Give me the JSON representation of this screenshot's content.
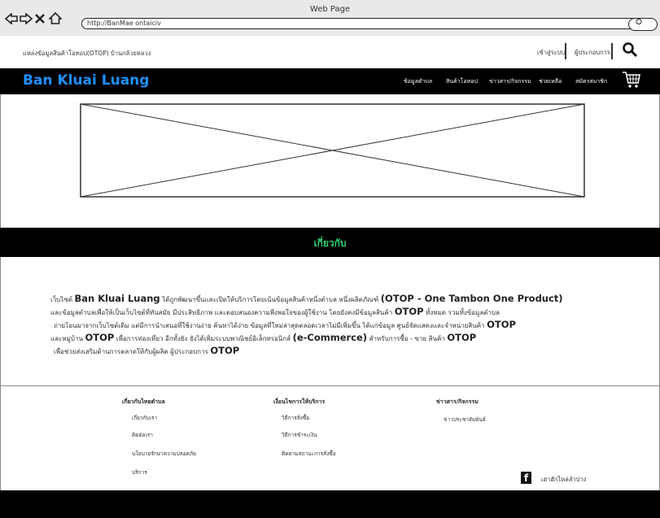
{
  "browser": {
    "window_title": "Web Page",
    "url": "http://BanMae ontaiciv"
  },
  "topbar": {
    "source_text": "แหล่งข้อมูลสินค้าโอทอป(OTOP) บ้านกล้วยหลวง",
    "login_label": "เข้าสู่ระบบ",
    "operator_label": "ผู้ประกอบการ"
  },
  "header": {
    "brand": "Ban Kluai Luang",
    "menu": [
      "ข้อมูลตำบล",
      "สินค้าโอทอป",
      "ข่าวสาร/กิจกรรม",
      "ช่วยเหลือ",
      "สมัครสมาชิก"
    ]
  },
  "about": {
    "title": "เกี่ยวกับ",
    "l1_a": "เว็บไซต์",
    "l1_brand": "Ban Kluai Luang",
    "l1_b": "ได้ถูกพัฒนาขึ้นและเปิดให้บริการโดยเน้นข้อมูลสินค้าหนึ่งตำบล หนึ่งผลิตภัณฑ์",
    "l1_otop": "(OTOP - One Tambon One Product)",
    "l2_a": "และข้อมูลตำบลเพื่อให้เป็นเว็บไซต์ที่ทันสมัย มีประสิทธิภาพ และตอบสนองความพึงพอใจของผู้ใช้งาน โดยยังคงมีข้อมูลสินค้า",
    "l2_otop": "OTOP",
    "l2_b": "ทั้งหมด รวมทั้งข้อมูลตำบล",
    "l3_a": "ถ่ายโอนมาจากเว็บไซต์เดิม แต่มีการนำเสนอที่ใช้งานง่าย ค้นหาได้ง่าย ข้อมูลที่ใหม่ล่าสุดตลอดเวลาไม่มีเพิ่มขึ้น ได้แก่ข้อมูล ศูนย์จัดแสดงและจำหน่ายสินค้า",
    "l3_otop": "OTOP",
    "l4_a": "และหมู่บ้าน",
    "l4_otop": "OTOP",
    "l4_b": "เพื่อการท่องเที่ยว อีกทั้งยัง ยังได้เพิ่มระบบพาณิชย์อิเล็กทรอนิกส์",
    "l4_ecom": "(e-Commerce)",
    "l4_c": "สำหรับการซื้อ - ขาย สินค้า",
    "l4_otop2": "OTOP",
    "l5_a": "เพื่อช่วยส่งเสริมด้านการตลาดให้กับผู้ผลิต ผู้ประกอบการ",
    "l5_otop": "OTOP"
  },
  "footer": {
    "col1": {
      "title": "เกี่ยวกับไทยตำบล",
      "links": [
        "เกี่ยวกับเรา",
        "ติดต่อเรา",
        "นโยบายรักษาความปลอดภัย",
        "บริการ"
      ]
    },
    "col2": {
      "title": "เงื่อนไขการให้บริการ",
      "links": [
        "วิธีการสั่งซื้อ",
        "วิธีการชำระเงิน",
        "ติดตามสถานะการสั่งซื้อ"
      ]
    },
    "col3": {
      "title": "ข่าวสาร/กิจกรรม",
      "links": [
        "ข่าวประชาสัมพันธ์"
      ]
    },
    "facebook_label": "เฮาฮักไหล่ลำปาง"
  },
  "colors": {
    "brand": "#1e90ff",
    "about_title": "#2ecc71",
    "bars": "#000000"
  }
}
